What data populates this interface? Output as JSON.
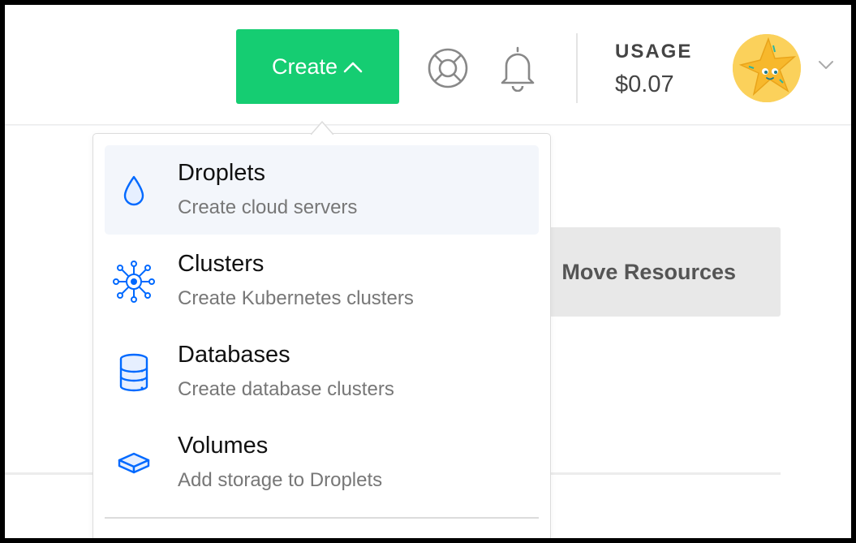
{
  "header": {
    "create_label": "Create",
    "usage_label": "USAGE",
    "usage_value": "$0.07"
  },
  "create_menu": {
    "items": [
      {
        "title": "Droplets",
        "subtitle": "Create cloud servers",
        "icon": "droplet-icon"
      },
      {
        "title": "Clusters",
        "subtitle": "Create Kubernetes clusters",
        "icon": "kubernetes-icon"
      },
      {
        "title": "Databases",
        "subtitle": "Create database clusters",
        "icon": "database-icon"
      },
      {
        "title": "Volumes",
        "subtitle": "Add storage to Droplets",
        "icon": "volume-icon"
      }
    ]
  },
  "main": {
    "move_resources_label": "Move Resources"
  },
  "colors": {
    "create_button": "#15cd72",
    "icon_blue": "#0069ff",
    "avatar_bg": "#fbd15b"
  }
}
